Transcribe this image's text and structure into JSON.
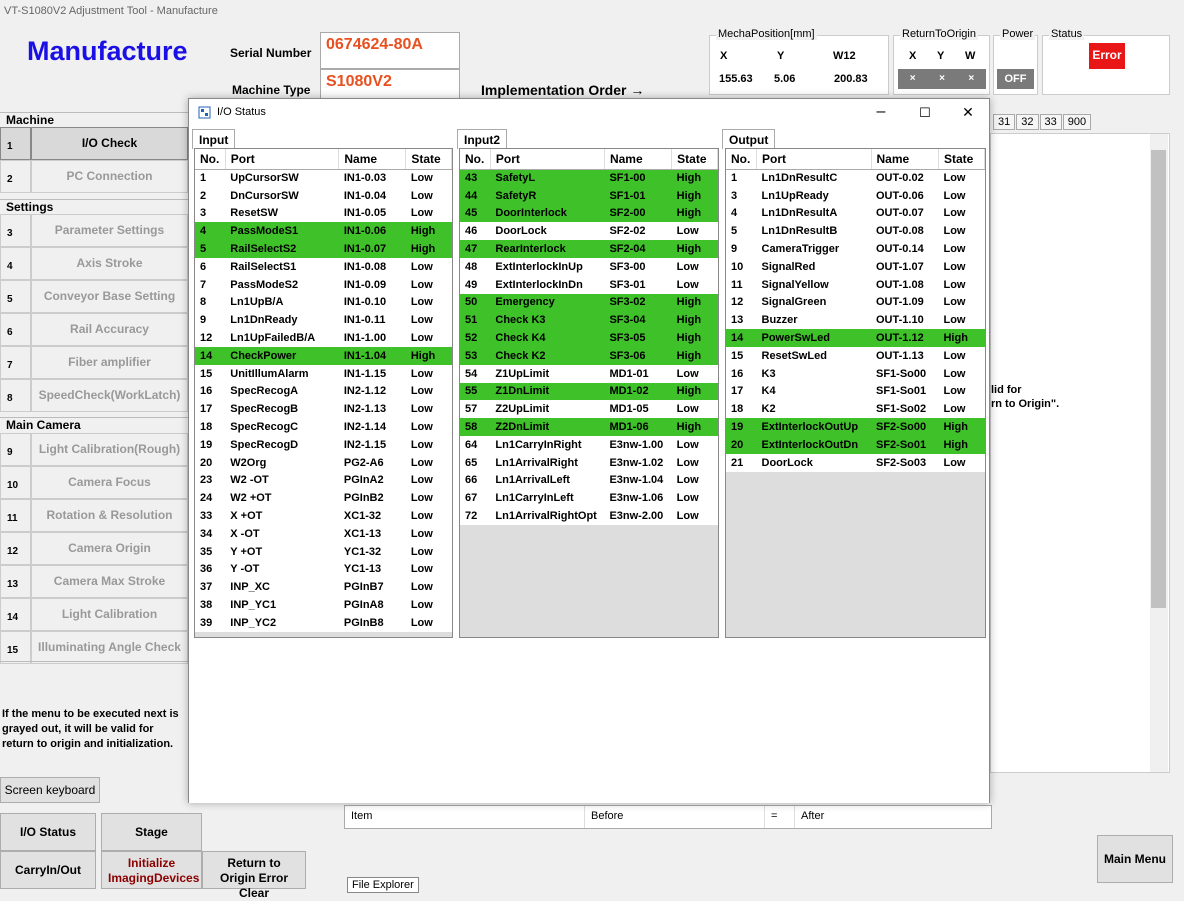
{
  "window_title": "VT-S1080V2 Adjustment Tool - Manufacture",
  "page_title": "Manufacture",
  "serial_label": "Serial Number",
  "serial_value": "0674624-80A",
  "machine_label": "Machine Type",
  "machine_value": "S1080V2",
  "impl_order": "Implementation Order →",
  "mecha": {
    "label": "MechaPosition[mm]",
    "x_label": "X",
    "y_label": "Y",
    "w_label": "W12",
    "x": "155.63",
    "y": "5.06",
    "w": "200.83"
  },
  "rto": {
    "label": "ReturnToOrigin",
    "x_label": "X",
    "y_label": "Y",
    "w_label": "W",
    "btn": "×"
  },
  "power": {
    "label": "Power",
    "value": "OFF"
  },
  "status": {
    "label": "Status",
    "value": "Error"
  },
  "sections": {
    "machine": "Machine",
    "settings": "Settings",
    "main_camera": "Main Camera"
  },
  "menu": [
    {
      "num": "1",
      "label": "I/O Check"
    },
    {
      "num": "2",
      "label": "PC Connection"
    },
    {
      "num": "3",
      "label": "Parameter Settings"
    },
    {
      "num": "4",
      "label": "Axis Stroke"
    },
    {
      "num": "5",
      "label": "Conveyor Base Setting"
    },
    {
      "num": "6",
      "label": "Rail Accuracy"
    },
    {
      "num": "7",
      "label": "Fiber amplifier"
    },
    {
      "num": "8",
      "label": "SpeedCheck(WorkLatch)"
    },
    {
      "num": "9",
      "label": "Light Calibration(Rough)"
    },
    {
      "num": "10",
      "label": "Camera Focus"
    },
    {
      "num": "11",
      "label": "Rotation & Resolution"
    },
    {
      "num": "12",
      "label": "Camera Origin"
    },
    {
      "num": "13",
      "label": "Camera Max Stroke"
    },
    {
      "num": "14",
      "label": "Light Calibration"
    },
    {
      "num": "15",
      "label": "Illuminating Angle Check"
    }
  ],
  "note": "If the menu to be executed next is grayed out, it will be valid for return to origin and initialization.",
  "bg_note": [
    "lid for",
    "rn to Origin\"."
  ],
  "tab_numbers": [
    "31",
    "32",
    "33",
    "900"
  ],
  "bottom_buttons": {
    "screen_keyboard": "Screen keyboard",
    "io_status": "I/O Status",
    "stage": "Stage",
    "carry": "CarryIn/Out",
    "init": "Initialize ImagingDevices",
    "rto_clear": "Return to Origin Error Clear",
    "main_menu": "Main Menu"
  },
  "bottom_table": {
    "item": "Item",
    "before": "Before",
    "eq": "=",
    "after": "After"
  },
  "file_explorer": "File Explorer",
  "dialog": {
    "title": "I/O Status",
    "minimize": "–",
    "maximize": "☐",
    "close": "✕",
    "columns": [
      "No.",
      "Port",
      "Name",
      "State"
    ],
    "input_tab": "Input",
    "input2_tab": "Input2",
    "output_tab": "Output",
    "input": [
      [
        "1",
        "UpCursorSW",
        "IN1-0.03",
        "Low"
      ],
      [
        "2",
        "DnCursorSW",
        "IN1-0.04",
        "Low"
      ],
      [
        "3",
        "ResetSW",
        "IN1-0.05",
        "Low"
      ],
      [
        "4",
        "PassModeS1",
        "IN1-0.06",
        "High"
      ],
      [
        "5",
        "RailSelectS2",
        "IN1-0.07",
        "High"
      ],
      [
        "6",
        "RailSelectS1",
        "IN1-0.08",
        "Low"
      ],
      [
        "7",
        "PassModeS2",
        "IN1-0.09",
        "Low"
      ],
      [
        "8",
        "Ln1UpB/A",
        "IN1-0.10",
        "Low"
      ],
      [
        "9",
        "Ln1DnReady",
        "IN1-0.11",
        "Low"
      ],
      [
        "12",
        "Ln1UpFailedB/A",
        "IN1-1.00",
        "Low"
      ],
      [
        "14",
        "CheckPower",
        "IN1-1.04",
        "High"
      ],
      [
        "15",
        "UnitIllumAlarm",
        "IN1-1.15",
        "Low"
      ],
      [
        "16",
        "SpecRecogA",
        "IN2-1.12",
        "Low"
      ],
      [
        "17",
        "SpecRecogB",
        "IN2-1.13",
        "Low"
      ],
      [
        "18",
        "SpecRecogC",
        "IN2-1.14",
        "Low"
      ],
      [
        "19",
        "SpecRecogD",
        "IN2-1.15",
        "Low"
      ],
      [
        "20",
        "W2Org",
        "PG2-A6",
        "Low"
      ],
      [
        "23",
        "W2 -OT",
        "PGInA2",
        "Low"
      ],
      [
        "24",
        "W2 +OT",
        "PGInB2",
        "Low"
      ],
      [
        "33",
        "X +OT",
        "XC1-32",
        "Low"
      ],
      [
        "34",
        "X -OT",
        "XC1-13",
        "Low"
      ],
      [
        "35",
        "Y +OT",
        "YC1-32",
        "Low"
      ],
      [
        "36",
        "Y -OT",
        "YC1-13",
        "Low"
      ],
      [
        "37",
        "INP_XC",
        "PGInB7",
        "Low"
      ],
      [
        "38",
        "INP_YC1",
        "PGInA8",
        "Low"
      ],
      [
        "39",
        "INP_YC2",
        "PGInB8",
        "Low"
      ]
    ],
    "input2": [
      [
        "43",
        "SafetyL",
        "SF1-00",
        "High"
      ],
      [
        "44",
        "SafetyR",
        "SF1-01",
        "High"
      ],
      [
        "45",
        "DoorInterlock",
        "SF2-00",
        "High"
      ],
      [
        "46",
        "DoorLock",
        "SF2-02",
        "Low"
      ],
      [
        "47",
        "RearInterlock",
        "SF2-04",
        "High"
      ],
      [
        "48",
        "ExtInterlockInUp",
        "SF3-00",
        "Low"
      ],
      [
        "49",
        "ExtInterlockInDn",
        "SF3-01",
        "Low"
      ],
      [
        "50",
        "Emergency",
        "SF3-02",
        "High"
      ],
      [
        "51",
        "Check K3",
        "SF3-04",
        "High"
      ],
      [
        "52",
        "Check K4",
        "SF3-05",
        "High"
      ],
      [
        "53",
        "Check K2",
        "SF3-06",
        "High"
      ],
      [
        "54",
        "Z1UpLimit",
        "MD1-01",
        "Low"
      ],
      [
        "55",
        "Z1DnLimit",
        "MD1-02",
        "High"
      ],
      [
        "57",
        "Z2UpLimit",
        "MD1-05",
        "Low"
      ],
      [
        "58",
        "Z2DnLimit",
        "MD1-06",
        "High"
      ],
      [
        "64",
        "Ln1CarryInRight",
        "E3nw-1.00",
        "Low"
      ],
      [
        "65",
        "Ln1ArrivalRight",
        "E3nw-1.02",
        "Low"
      ],
      [
        "66",
        "Ln1ArrivalLeft",
        "E3nw-1.04",
        "Low"
      ],
      [
        "67",
        "Ln1CarryInLeft",
        "E3nw-1.06",
        "Low"
      ],
      [
        "72",
        "Ln1ArrivalRightOpt",
        "E3nw-2.00",
        "Low"
      ]
    ],
    "output": [
      [
        "1",
        "Ln1DnResultC",
        "OUT-0.02",
        "Low"
      ],
      [
        "3",
        "Ln1UpReady",
        "OUT-0.06",
        "Low"
      ],
      [
        "4",
        "Ln1DnResultA",
        "OUT-0.07",
        "Low"
      ],
      [
        "5",
        "Ln1DnResultB",
        "OUT-0.08",
        "Low"
      ],
      [
        "9",
        "CameraTrigger",
        "OUT-0.14",
        "Low"
      ],
      [
        "10",
        "SignalRed",
        "OUT-1.07",
        "Low"
      ],
      [
        "11",
        "SignalYellow",
        "OUT-1.08",
        "Low"
      ],
      [
        "12",
        "SignalGreen",
        "OUT-1.09",
        "Low"
      ],
      [
        "13",
        "Buzzer",
        "OUT-1.10",
        "Low"
      ],
      [
        "14",
        "PowerSwLed",
        "OUT-1.12",
        "High"
      ],
      [
        "15",
        "ResetSwLed",
        "OUT-1.13",
        "Low"
      ],
      [
        "16",
        "K3",
        "SF1-So00",
        "Low"
      ],
      [
        "17",
        "K4",
        "SF1-So01",
        "Low"
      ],
      [
        "18",
        "K2",
        "SF1-So02",
        "Low"
      ],
      [
        "19",
        "ExtInterlockOutUp",
        "SF2-So00",
        "High"
      ],
      [
        "20",
        "ExtInterlockOutDn",
        "SF2-So01",
        "High"
      ],
      [
        "21",
        "DoorLock",
        "SF2-So03",
        "Low"
      ]
    ]
  }
}
